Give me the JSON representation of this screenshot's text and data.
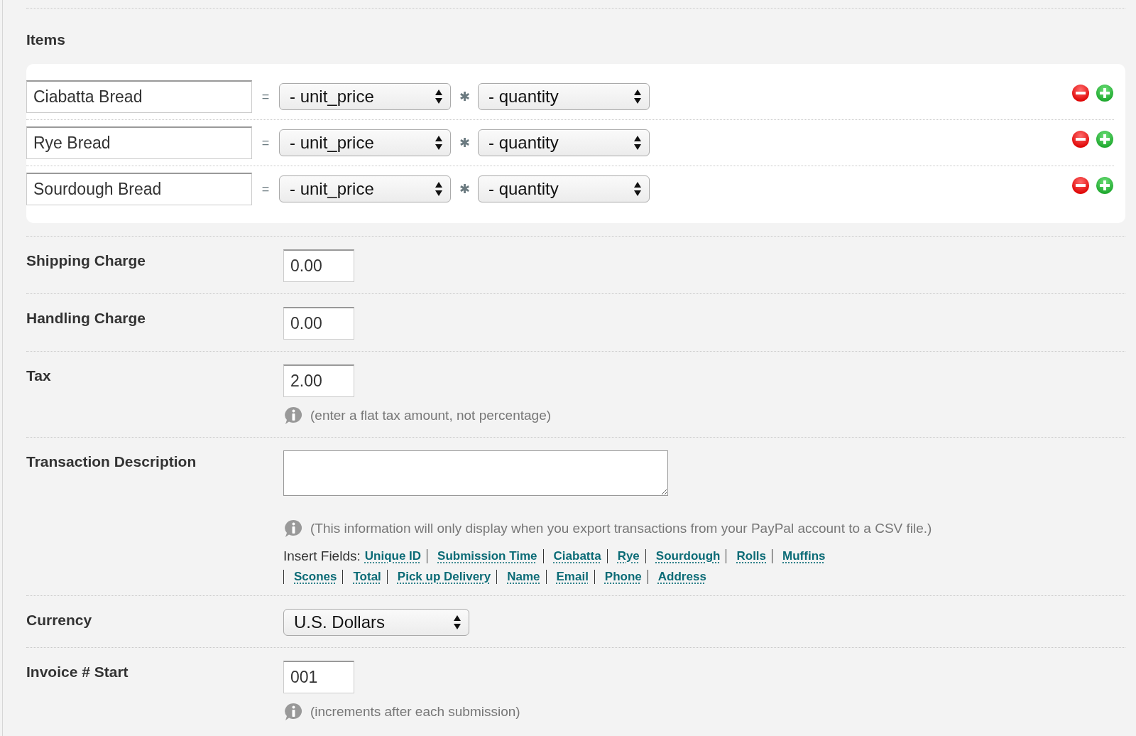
{
  "items_section": {
    "title": "Items",
    "rows": [
      {
        "name": "Ciabatta Bread",
        "operator": "=",
        "price_field": "- unit_price",
        "multiply": "✱",
        "quantity_field": "- quantity"
      },
      {
        "name": "Rye Bread",
        "operator": "=",
        "price_field": "- unit_price",
        "multiply": "✱",
        "quantity_field": "- quantity"
      },
      {
        "name": "Sourdough Bread",
        "operator": "=",
        "price_field": "- unit_price",
        "multiply": "✱",
        "quantity_field": "- quantity"
      }
    ]
  },
  "fields": [
    {
      "kind": "text",
      "label": "Shipping Charge",
      "value": "0.00"
    },
    {
      "kind": "text",
      "label": "Handling Charge",
      "value": "0.00"
    },
    {
      "kind": "text",
      "label": "Tax",
      "value": "2.00",
      "note": "(enter a flat tax amount, not percentage)"
    },
    {
      "kind": "textarea",
      "label": "Transaction Description",
      "note": "(This information will only display when you export transactions from your PayPal account to a CSV file.)",
      "insert_label": "Insert Fields:",
      "links": [
        "Unique ID",
        "Submission Time",
        "Ciabatta",
        "Rye",
        "Sourdough",
        "Rolls",
        "Muffins",
        "Scones",
        "Total",
        "Pick up Delivery",
        "Name",
        "Email",
        "Phone",
        "Address"
      ]
    },
    {
      "kind": "select",
      "label": "Currency",
      "value": "U.S. Dollars"
    },
    {
      "kind": "text",
      "label": "Invoice # Start",
      "value": "001",
      "note": "(increments after each submission)"
    }
  ]
}
